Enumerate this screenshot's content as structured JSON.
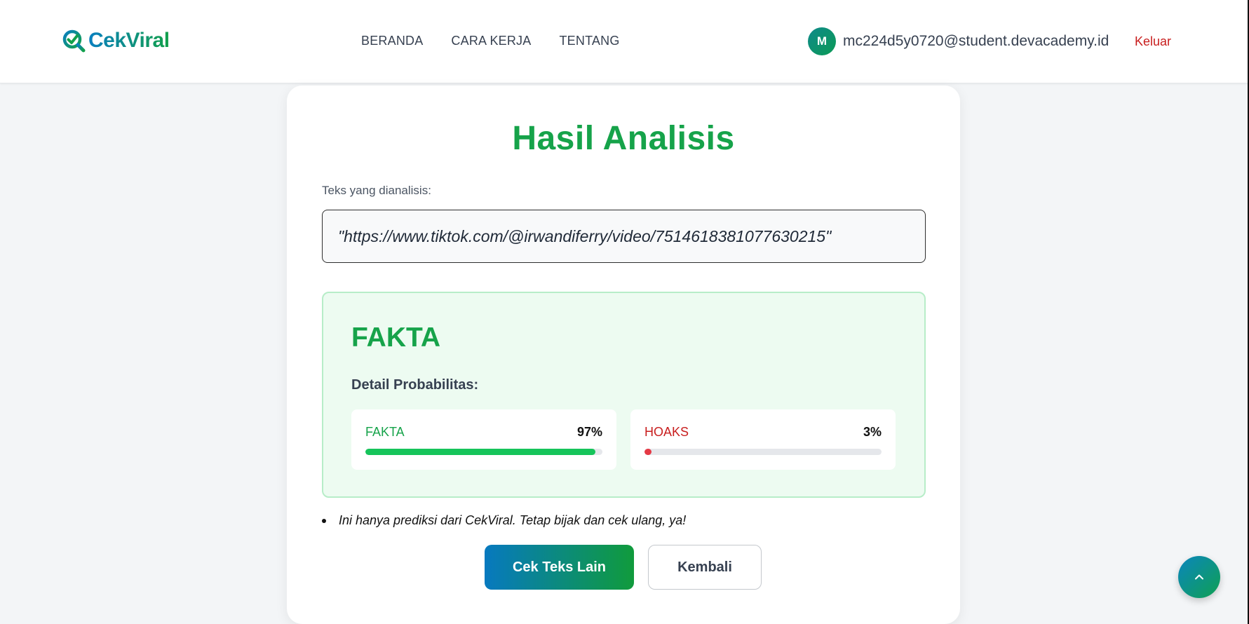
{
  "header": {
    "logo_text": "CekViral",
    "nav": [
      {
        "label": "BERANDA"
      },
      {
        "label": "CARA KERJA"
      },
      {
        "label": "TENTANG"
      }
    ],
    "user": {
      "avatar_initial": "M",
      "email": "mc224d5y0720@student.devacademy.id"
    },
    "logout_label": "Keluar"
  },
  "main": {
    "title": "Hasil Analisis",
    "analyzed_label": "Teks yang dianalisis:",
    "analyzed_text": "\"https://www.tiktok.com/@irwandiferry/video/7514618381077630215\"",
    "result": {
      "verdict": "FAKTA",
      "probability_title": "Detail Probabilitas:",
      "items": [
        {
          "name": "FAKTA",
          "value_label": "97%",
          "value": 0.97,
          "color": "#16c45a",
          "text_color": "#16a34a"
        },
        {
          "name": "HOAKS",
          "value_label": "3%",
          "value": 0.03,
          "color": "#e53945",
          "text_color": "#c81e1e"
        }
      ]
    },
    "note": "Ini hanya prediksi dari CekViral. Tetap bijak dan cek ulang, ya!",
    "buttons": {
      "check_other": "Cek Teks Lain",
      "back": "Kembali"
    }
  },
  "scroll_top_icon": "chevron-up-icon",
  "colors": {
    "brand_green": "#16a34a",
    "brand_blue": "#0779bf",
    "danger_red": "#c81e1e"
  }
}
